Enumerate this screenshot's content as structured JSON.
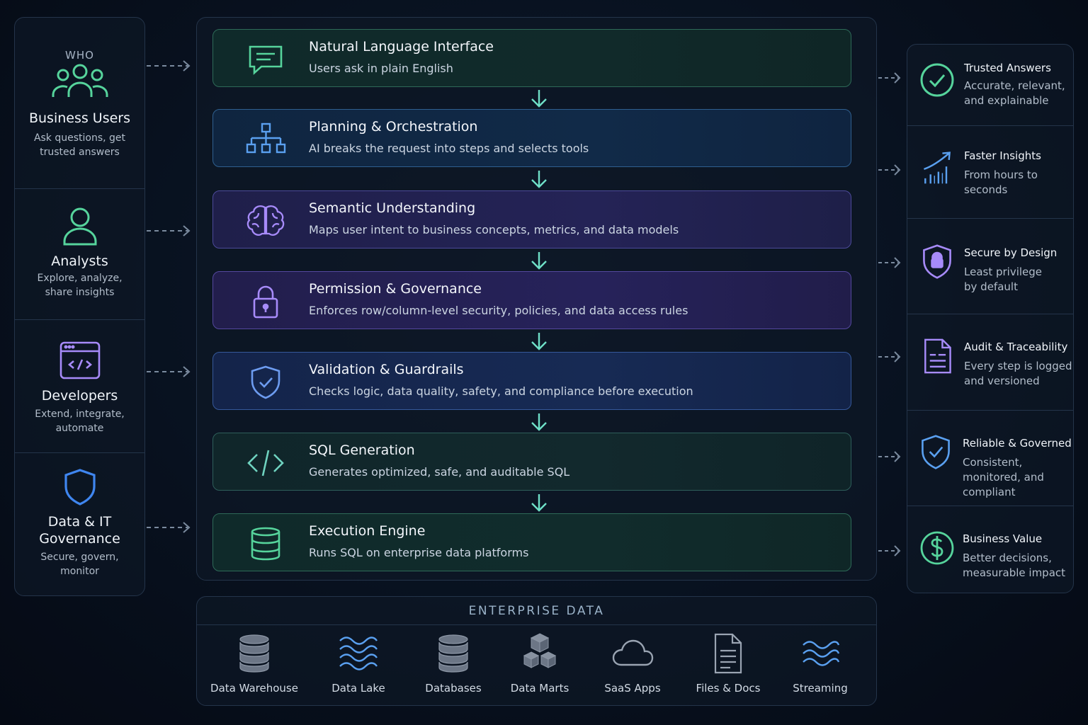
{
  "who": {
    "heading": "WHO",
    "items": [
      {
        "title": "Business Users",
        "desc": "Ask questions, get trusted answers",
        "icon": "users-icon"
      },
      {
        "title": "Analysts",
        "desc": "Explore, analyze, share insights",
        "icon": "user-icon"
      },
      {
        "title": "Developers",
        "desc": "Extend, integrate, automate",
        "icon": "code-window-icon"
      },
      {
        "title": "Data & IT Governance",
        "desc": "Secure, govern, monitor",
        "icon": "shield-icon"
      }
    ]
  },
  "pipeline": {
    "steps": [
      {
        "title": "Natural Language Interface",
        "desc": "Users ask in plain English",
        "icon": "chat-icon"
      },
      {
        "title": "Planning & Orchestration",
        "desc": "AI breaks the request into steps and selects tools",
        "icon": "hierarchy-icon"
      },
      {
        "title": "Semantic Understanding",
        "desc": "Maps user intent to business concepts, metrics, and data models",
        "icon": "brain-icon"
      },
      {
        "title": "Permission & Governance",
        "desc": "Enforces row/column-level security, policies, and data access rules",
        "icon": "lock-icon"
      },
      {
        "title": "Validation & Guardrails",
        "desc": "Checks logic, data quality, safety, and compliance before execution",
        "icon": "shield-check-icon"
      },
      {
        "title": "SQL Generation",
        "desc": "Generates optimized, safe, and auditable SQL",
        "icon": "code-icon"
      },
      {
        "title": "Execution Engine",
        "desc": "Runs SQL on enterprise data platforms",
        "icon": "database-icon"
      }
    ]
  },
  "outcomes": {
    "items": [
      {
        "title": "Trusted Answers",
        "desc": "Accurate, relevant, and explainable",
        "icon": "check-circle-icon"
      },
      {
        "title": "Faster Insights",
        "desc": "From hours to seconds",
        "icon": "growth-chart-icon"
      },
      {
        "title": "Secure by Design",
        "desc": "Least privilege by default",
        "icon": "shield-lock-icon"
      },
      {
        "title": "Audit & Traceability",
        "desc": "Every step is logged and versioned",
        "icon": "document-icon"
      },
      {
        "title": "Reliable & Governed",
        "desc": "Consistent, monitored, and compliant",
        "icon": "shield-check-icon"
      },
      {
        "title": "Business Value",
        "desc": "Better decisions, measurable impact",
        "icon": "dollar-icon"
      }
    ]
  },
  "enterprise": {
    "title": "ENTERPRISE DATA",
    "sources": [
      {
        "label": "Data Warehouse",
        "icon": "database-icon"
      },
      {
        "label": "Data Lake",
        "icon": "waves-icon"
      },
      {
        "label": "Databases",
        "icon": "database-icon"
      },
      {
        "label": "Data Marts",
        "icon": "cubes-icon"
      },
      {
        "label": "SaaS Apps",
        "icon": "cloud-icon"
      },
      {
        "label": "Files & Docs",
        "icon": "file-icon"
      },
      {
        "label": "Streaming",
        "icon": "stream-icon"
      }
    ]
  },
  "colors": {
    "green": "#56d49c",
    "blue": "#5aa0f0",
    "purple": "#a78bfa",
    "teal": "#6fe0c8"
  }
}
